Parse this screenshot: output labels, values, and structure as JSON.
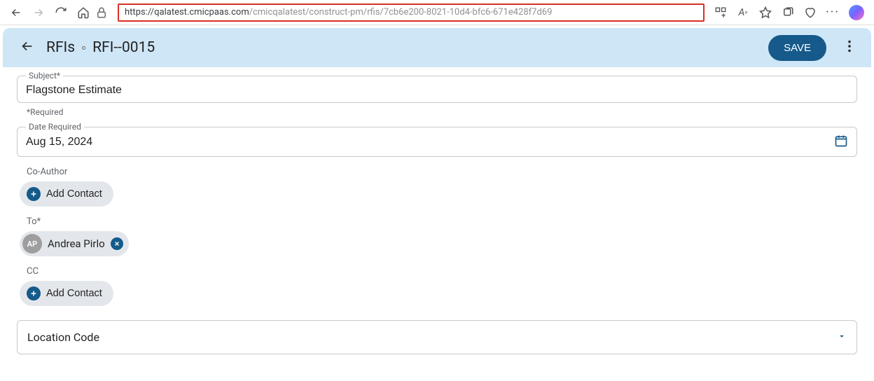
{
  "browser": {
    "url_host": "https://qalatest.cmicpaas.com",
    "url_path": "/cmicqalatest/construct-pm/rfis/7cb6e200-8021-10d4-bfc6-671e428f7d69"
  },
  "header": {
    "breadcrumb_root": "RFIs",
    "breadcrumb_current": "RFI--0015",
    "save_label": "SAVE"
  },
  "form": {
    "subject": {
      "label": "Subject*",
      "value": "Flagstone Estimate",
      "help": "*Required"
    },
    "date_required": {
      "label": "Date Required",
      "value": "Aug 15, 2024"
    },
    "co_author": {
      "label": "Co-Author",
      "add_label": "Add Contact"
    },
    "to": {
      "label": "To*",
      "contact": {
        "initials": "AP",
        "name": "Andrea Pirlo"
      }
    },
    "cc": {
      "label": "CC",
      "add_label": "Add Contact"
    },
    "location": {
      "placeholder": "Location Code"
    }
  }
}
